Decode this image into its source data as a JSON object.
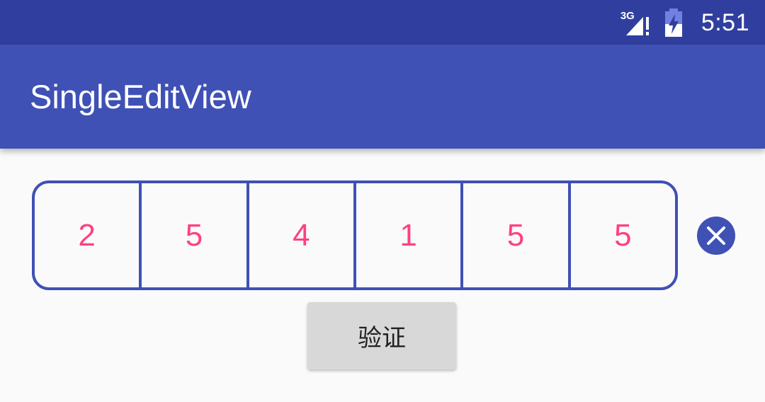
{
  "status_bar": {
    "network_label": "3G",
    "time": "5:51",
    "background": "#303f9f"
  },
  "app_bar": {
    "title": "SingleEditView",
    "background": "#3f51b5"
  },
  "code_input": {
    "digits": [
      "2",
      "5",
      "4",
      "1",
      "5",
      "5"
    ],
    "border_color": "#3f51b5",
    "digit_color": "#ff4081"
  },
  "clear_button": {
    "icon": "close-circle-icon"
  },
  "verify_button": {
    "label": "验证"
  }
}
